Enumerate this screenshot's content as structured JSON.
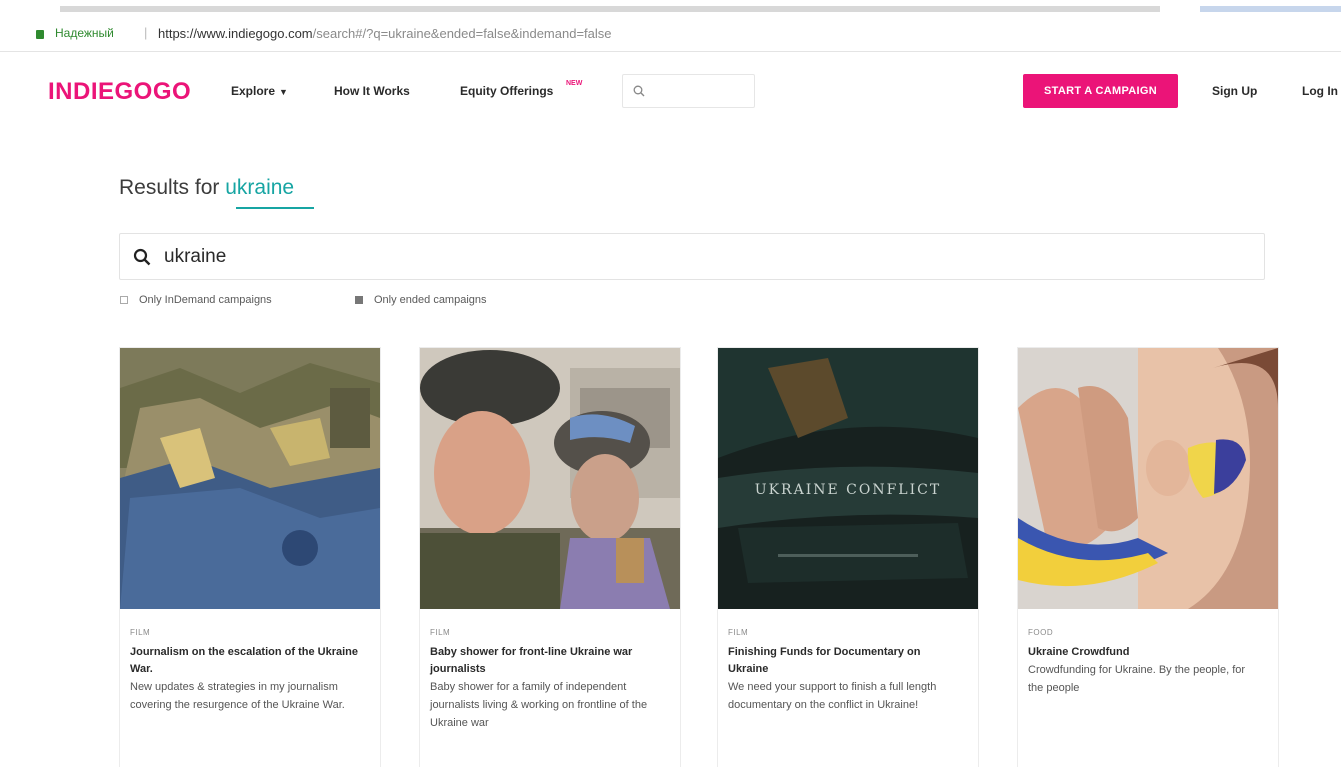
{
  "browser": {
    "secure_label": "Надежный",
    "url_host": "https://www.indiegogo.com",
    "url_rest": "/search#/?q=ukraine&ended=false&indemand=false"
  },
  "header": {
    "logo": "INDIEGOGO",
    "nav": {
      "explore": "Explore",
      "how_it_works": "How It Works",
      "equity_offerings": "Equity Offerings",
      "equity_badge": "NEW"
    },
    "start_campaign": "START A CAMPAIGN",
    "sign_up": "Sign Up",
    "log_in": "Log In"
  },
  "results": {
    "prefix": "Results for",
    "term": "ukraine"
  },
  "search": {
    "value": "ukraine"
  },
  "filters": {
    "indemand": {
      "label": "Only InDemand campaigns",
      "checked": false
    },
    "ended": {
      "label": "Only ended campaigns",
      "checked": true
    }
  },
  "cards": [
    {
      "category": "FILM",
      "title": "Journalism on the escalation of the Ukraine War.",
      "description": "New updates & strategies in my journalism covering the resurgence of the Ukraine War."
    },
    {
      "category": "FILM",
      "title": "Baby shower for front-line Ukraine war journalists",
      "description": "Baby shower for a family of independent journalists living & working on frontline of the Ukraine war"
    },
    {
      "category": "FILM",
      "title": "Finishing Funds for Documentary on Ukraine",
      "description": "We need your support to finish a full length documentary on the conflict in Ukraine!",
      "image_text": "UKRAINE CONFLICT"
    },
    {
      "category": "FOOD",
      "title": "Ukraine Crowdfund",
      "description": "Crowdfunding for Ukraine. By the people, for the people"
    }
  ],
  "colors": {
    "brand": "#eb1478",
    "accent": "#17a5a3"
  }
}
